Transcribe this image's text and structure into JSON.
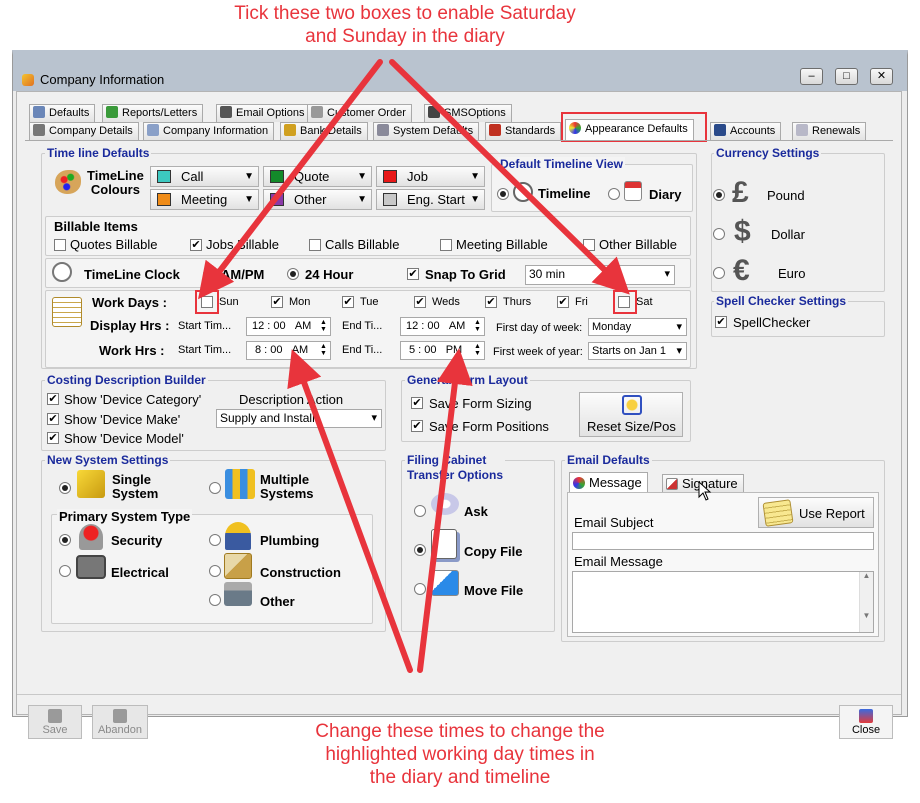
{
  "annotations": {
    "top": "Tick these two boxes to enable Saturday\nand Sunday in the diary",
    "bottom": "Change these times to change the\nhighlighted working day times in\nthe diary and timeline"
  },
  "window": {
    "title": "Company Information",
    "min": "–",
    "max": "□",
    "close": "✕"
  },
  "tabs_row1": [
    "Defaults",
    "Reports/Letters",
    "Email Options",
    "Customer Order",
    "SMSOptions"
  ],
  "tabs_row2": [
    "Company Details",
    "Company Information",
    "Bank Details",
    "System Defaults",
    "Standards",
    "Appearance Defaults",
    "Accounts",
    "Renewals"
  ],
  "timeline": {
    "title": "Time line Defaults",
    "colours_label": "TimeLine\nColours",
    "colours": [
      {
        "label": "Call",
        "color": "#3cc8c0"
      },
      {
        "label": "Quote",
        "color": "#138a2a"
      },
      {
        "label": "Job",
        "color": "#e81818"
      },
      {
        "label": "Meeting",
        "color": "#f08c18"
      },
      {
        "label": "Other",
        "color": "#8a3aa8"
      },
      {
        "label": "Eng. Start",
        "color": "#c8c8c8"
      }
    ],
    "billable_title": "Billable Items",
    "billable": [
      {
        "label": "Quotes Billable",
        "checked": false
      },
      {
        "label": "Jobs Billable",
        "checked": true
      },
      {
        "label": "Calls Billable",
        "checked": false
      },
      {
        "label": "Meeting Billable",
        "checked": false
      },
      {
        "label": "Other Billable",
        "checked": false
      }
    ],
    "clock_label": "TimeLine Clock",
    "clock_ampm": "AM/PM",
    "clock_24": "24 Hour",
    "snap_label": "Snap To Grid",
    "snap_value": "30 min",
    "workdays_label": "Work Days :",
    "days": [
      {
        "label": "Sun",
        "checked": false
      },
      {
        "label": "Mon",
        "checked": true
      },
      {
        "label": "Tue",
        "checked": true
      },
      {
        "label": "Weds",
        "checked": true
      },
      {
        "label": "Thurs",
        "checked": true
      },
      {
        "label": "Fri",
        "checked": true
      },
      {
        "label": "Sat",
        "checked": false
      }
    ],
    "display_label": "Display Hrs :",
    "work_label": "Work Hrs :",
    "start_time_label": "Start Tim...",
    "end_time_label": "End Ti...",
    "display_start": {
      "h": "12",
      "m": "00",
      "ap": "AM"
    },
    "display_end": {
      "h": "12",
      "m": "00",
      "ap": "AM"
    },
    "work_start": {
      "h": "8",
      "m": "00",
      "ap": "AM"
    },
    "work_end": {
      "h": "5",
      "m": "00",
      "ap": "PM"
    },
    "first_day_label": "First day of week:",
    "first_day_value": "Monday",
    "first_week_label": "First week of year:",
    "first_week_value": "Starts on Jan 1"
  },
  "default_view": {
    "title": "Default Timeline View",
    "timeline": "Timeline",
    "diary": "Diary"
  },
  "currency": {
    "title": "Currency Settings",
    "items": [
      "Pound",
      "Dollar",
      "Euro"
    ],
    "symbols": [
      "£",
      "$",
      "€"
    ]
  },
  "spell": {
    "title": "Spell Checker Settings",
    "label": "SpellChecker"
  },
  "costing": {
    "title": "Costing Description Builder",
    "items": [
      "Show 'Device Category'",
      "Show 'Device Make'",
      "Show 'Device Model'"
    ],
    "action_label": "Description Action",
    "action_value": "Supply and Install"
  },
  "layout": {
    "title": "General Form Layout",
    "items": [
      "Save Form Sizing",
      "Save Form Positions"
    ],
    "reset": "Reset Size/Pos"
  },
  "newsys": {
    "title": "New System Settings",
    "single": "Single\nSystem",
    "multiple": "Multiple\nSystems",
    "primary_title": "Primary System Type",
    "types": [
      "Security",
      "Plumbing",
      "Electrical",
      "Construction",
      "Other"
    ]
  },
  "filing": {
    "title": "Filing Cabinet\nTransfer Options",
    "items": [
      "Ask",
      "Copy File",
      "Move File"
    ]
  },
  "email": {
    "title": "Email Defaults",
    "tabs": [
      "Message",
      "Signature"
    ],
    "use_report": "Use Report",
    "subject_label": "Email Subject",
    "message_label": "Email Message"
  },
  "buttons": {
    "save": "Save",
    "abandon": "Abandon",
    "close": "Close"
  }
}
